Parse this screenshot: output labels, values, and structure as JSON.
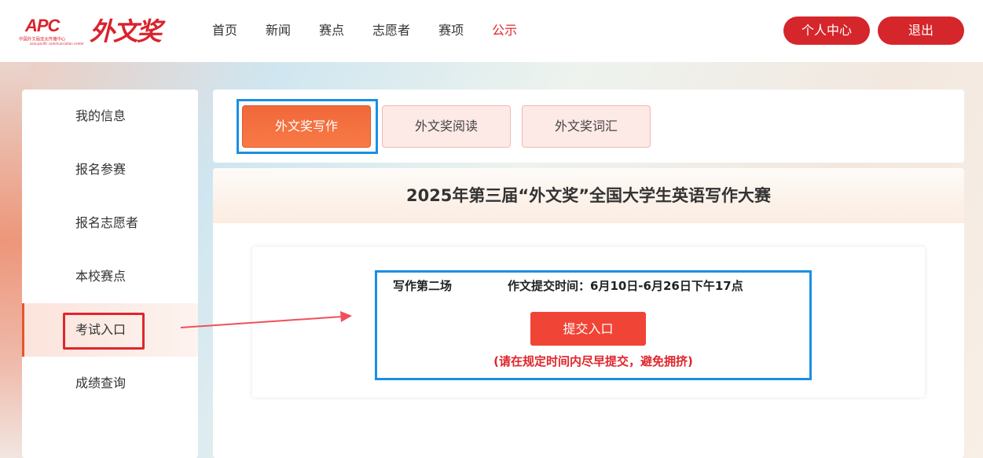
{
  "header": {
    "logo_apc_text": "APC",
    "logo_apc_sub": "中国外文局亚太传播中心",
    "logo_apc_sub2": "asia-pacific communication center",
    "logo_brand": "外文奖",
    "nav": [
      {
        "label": "首页"
      },
      {
        "label": "新闻"
      },
      {
        "label": "赛点"
      },
      {
        "label": "志愿者"
      },
      {
        "label": "赛项"
      },
      {
        "label": "公示"
      }
    ],
    "active_nav": "公示",
    "user_center_label": "个人中心",
    "logout_label": "退出"
  },
  "sidebar": {
    "items": [
      {
        "label": "我的信息"
      },
      {
        "label": "报名参赛"
      },
      {
        "label": "报名志愿者"
      },
      {
        "label": "本校赛点"
      },
      {
        "label": "考试入口"
      },
      {
        "label": "成绩查询"
      }
    ],
    "active_item": "考试入口"
  },
  "tabs": [
    {
      "label": "外文奖写作"
    },
    {
      "label": "外文奖阅读"
    },
    {
      "label": "外文奖词汇"
    }
  ],
  "main": {
    "title": "2025年第三届“外文奖”全国大学生英语写作大赛",
    "exam": {
      "name": "写作第二场",
      "time": "作文提交时间：6月10日-6月26日下午17点",
      "submit_label": "提交入口",
      "notice": "(请在规定时间内尽早提交，避免拥挤)"
    }
  },
  "colors": {
    "brand_red": "#d4262b",
    "active_tab": "#f0683b",
    "highlight_blue": "#1a8fe3",
    "notice_red": "#e0262c"
  }
}
